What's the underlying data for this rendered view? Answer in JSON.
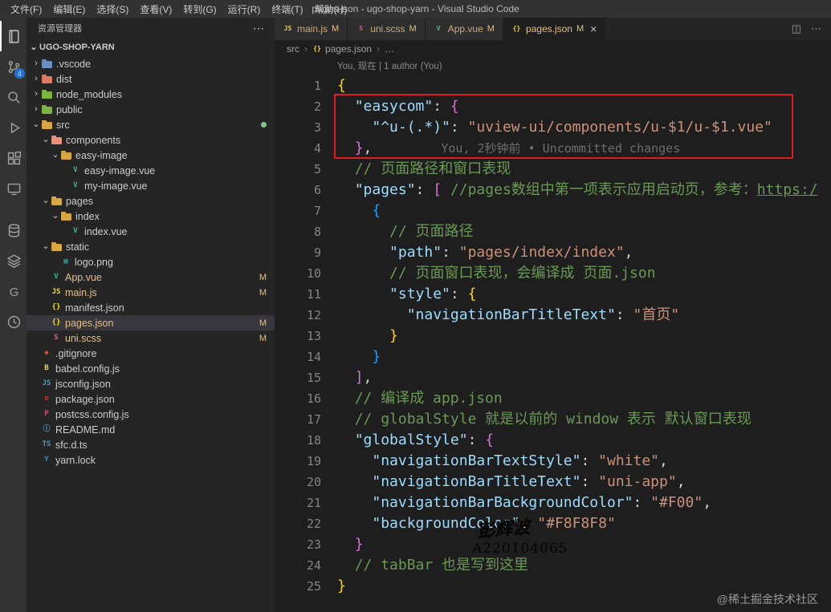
{
  "titlebar": {
    "menus": [
      "文件(F)",
      "编辑(E)",
      "选择(S)",
      "查看(V)",
      "转到(G)",
      "运行(R)",
      "终端(T)",
      "帮助(H)"
    ],
    "title": "pages.json - ugo-shop-yarn - Visual Studio Code"
  },
  "activity_bar": {
    "items": [
      {
        "icon": "explorer",
        "active": true
      },
      {
        "icon": "source-control",
        "badge": "4"
      },
      {
        "icon": "search"
      },
      {
        "icon": "run-debug"
      },
      {
        "icon": "extensions"
      },
      {
        "icon": "remote"
      },
      {
        "icon": "database",
        "group2": true
      },
      {
        "icon": "layers"
      },
      {
        "icon": "gitlens"
      },
      {
        "icon": "timeline"
      }
    ]
  },
  "sidebar": {
    "header": "资源管理器",
    "more_icon": "⋯",
    "project": "UGO-SHOP-YARN",
    "tree": [
      {
        "label": ".vscode",
        "level": 0,
        "kind": "folder",
        "icon": "folder-vscode",
        "expanded": false
      },
      {
        "label": "dist",
        "level": 0,
        "kind": "folder",
        "icon": "folder-dist",
        "expanded": false
      },
      {
        "label": "node_modules",
        "level": 0,
        "kind": "folder",
        "icon": "folder-node",
        "expanded": false
      },
      {
        "label": "public",
        "level": 0,
        "kind": "folder",
        "icon": "folder-public",
        "expanded": false
      },
      {
        "label": "src",
        "level": 0,
        "kind": "folder",
        "icon": "folder-src",
        "expanded": true,
        "dot": true
      },
      {
        "label": "components",
        "level": 1,
        "kind": "folder",
        "icon": "folder-components",
        "expanded": true
      },
      {
        "label": "easy-image",
        "level": 2,
        "kind": "folder",
        "icon": "folder-default",
        "expanded": true
      },
      {
        "label": "easy-image.vue",
        "level": 3,
        "kind": "file",
        "icon": "vue"
      },
      {
        "label": "my-image.vue",
        "level": 3,
        "kind": "file",
        "icon": "vue"
      },
      {
        "label": "pages",
        "level": 1,
        "kind": "folder",
        "icon": "folder-default",
        "expanded": true
      },
      {
        "label": "index",
        "level": 2,
        "kind": "folder",
        "icon": "folder-default",
        "expanded": true
      },
      {
        "label": "index.vue",
        "level": 3,
        "kind": "file",
        "icon": "vue"
      },
      {
        "label": "static",
        "level": 1,
        "kind": "folder",
        "icon": "folder-default",
        "expanded": true
      },
      {
        "label": "logo.png",
        "level": 2,
        "kind": "file",
        "icon": "image"
      },
      {
        "label": "App.vue",
        "level": 1,
        "kind": "file",
        "icon": "vue",
        "badge": "M",
        "modified": true
      },
      {
        "label": "main.js",
        "level": 1,
        "kind": "file",
        "icon": "js",
        "badge": "M",
        "modified": true
      },
      {
        "label": "manifest.json",
        "level": 1,
        "kind": "file",
        "icon": "json"
      },
      {
        "label": "pages.json",
        "level": 1,
        "kind": "file",
        "icon": "json",
        "badge": "M",
        "modified": true,
        "selected": true
      },
      {
        "label": "uni.scss",
        "level": 1,
        "kind": "file",
        "icon": "scss",
        "badge": "M",
        "modified": true
      },
      {
        "label": ".gitignore",
        "level": 0,
        "kind": "file",
        "icon": "git"
      },
      {
        "label": "babel.config.js",
        "level": 0,
        "kind": "file",
        "icon": "babel"
      },
      {
        "label": "jsconfig.json",
        "level": 0,
        "kind": "file",
        "icon": "jsconfig"
      },
      {
        "label": "package.json",
        "level": 0,
        "kind": "file",
        "icon": "npm"
      },
      {
        "label": "postcss.config.js",
        "level": 0,
        "kind": "file",
        "icon": "postcss"
      },
      {
        "label": "README.md",
        "level": 0,
        "kind": "file",
        "icon": "readme"
      },
      {
        "label": "sfc.d.ts",
        "level": 0,
        "kind": "file",
        "icon": "ts"
      },
      {
        "label": "yarn.lock",
        "level": 0,
        "kind": "file",
        "icon": "yarn"
      }
    ]
  },
  "icon_map": {
    "folder-vscode": {
      "shape": "folder",
      "color": "#6c8ebf",
      "name": "vscode-folder-icon"
    },
    "folder-dist": {
      "shape": "folder",
      "color": "#e07a5f",
      "name": "dist-folder-icon"
    },
    "folder-node": {
      "shape": "folder",
      "color": "#7cb342",
      "name": "node-modules-folder-icon"
    },
    "folder-public": {
      "shape": "folder",
      "color": "#7cb342",
      "name": "public-folder-icon"
    },
    "folder-src": {
      "shape": "folder",
      "color": "#d9a741",
      "name": "src-folder-icon"
    },
    "folder-components": {
      "shape": "folder",
      "color": "#e8927c",
      "name": "components-folder-icon"
    },
    "folder-default": {
      "shape": "folder",
      "color": "#d9a741",
      "name": "folder-icon"
    },
    "vue": {
      "glyph": "V",
      "color": "#41b883",
      "name": "vue-file-icon"
    },
    "js": {
      "glyph": "JS",
      "color": "#e8d44d",
      "name": "js-file-icon"
    },
    "json": {
      "glyph": "{}",
      "color": "#f5de19",
      "name": "json-file-icon"
    },
    "scss": {
      "glyph": "S",
      "color": "#cd6799",
      "name": "scss-file-icon"
    },
    "image": {
      "glyph": "▦",
      "color": "#26a69a",
      "name": "image-file-icon"
    },
    "git": {
      "glyph": "◆",
      "color": "#e84e31",
      "name": "git-file-icon"
    },
    "babel": {
      "glyph": "B",
      "color": "#f0d95b",
      "name": "babel-file-icon"
    },
    "jsconfig": {
      "glyph": "JS",
      "color": "#519aba",
      "name": "jsconfig-file-icon"
    },
    "npm": {
      "glyph": "n",
      "color": "#cb3837",
      "name": "npm-file-icon"
    },
    "postcss": {
      "glyph": "P",
      "color": "#dd4a68",
      "name": "postcss-file-icon"
    },
    "readme": {
      "glyph": "ⓘ",
      "color": "#42a5f5",
      "name": "readme-file-icon"
    },
    "ts": {
      "glyph": "TS",
      "color": "#519aba",
      "name": "ts-file-icon"
    },
    "yarn": {
      "glyph": "Y",
      "color": "#2c8ebb",
      "name": "yarn-file-icon"
    }
  },
  "tabs": [
    {
      "label": "main.js",
      "icon": "js",
      "badge": "M",
      "active": false
    },
    {
      "label": "uni.scss",
      "icon": "scss",
      "badge": "M",
      "active": false
    },
    {
      "label": "App.vue",
      "icon": "vue",
      "badge": "M",
      "active": false
    },
    {
      "label": "pages.json",
      "icon": "json",
      "badge": "M",
      "active": true
    }
  ],
  "tab_actions": [
    {
      "name": "split-editor-icon",
      "glyph": "◫"
    },
    {
      "name": "more-actions-icon",
      "glyph": "⋯"
    }
  ],
  "breadcrumb": [
    {
      "label": "src"
    },
    {
      "label": "pages.json",
      "icon": "json"
    },
    {
      "label": "…"
    }
  ],
  "editor": {
    "codelens": "You, 现在 | 1 author (You)",
    "lines": [
      [
        {
          "t": "{",
          "c": "b1"
        }
      ],
      [
        {
          "t": "  ",
          "c": "p"
        },
        {
          "t": "\"easycom\"",
          "c": "key"
        },
        {
          "t": ": ",
          "c": "p"
        },
        {
          "t": "{",
          "c": "b2"
        }
      ],
      [
        {
          "t": "    ",
          "c": "p"
        },
        {
          "t": "\"^u-(.*)\"",
          "c": "key"
        },
        {
          "t": ": ",
          "c": "p"
        },
        {
          "t": "\"uview-ui/components/u-$1/u-$1.vue\"",
          "c": "str"
        }
      ],
      [
        {
          "t": "  ",
          "c": "p"
        },
        {
          "t": "}",
          "c": "b2"
        },
        {
          "t": ",",
          "c": "p"
        },
        {
          "t": "You, 2秒钟前 • Uncommitted changes",
          "c": "blame"
        }
      ],
      [
        {
          "t": "  ",
          "c": "p"
        },
        {
          "t": "// 页面路径和窗口表现",
          "c": "com"
        }
      ],
      [
        {
          "t": "  ",
          "c": "p"
        },
        {
          "t": "\"pages\"",
          "c": "key"
        },
        {
          "t": ": ",
          "c": "p"
        },
        {
          "t": "[",
          "c": "b2"
        },
        {
          "t": " ",
          "c": "p"
        },
        {
          "t": "//pages数组中第一项表示应用启动页，参考：",
          "c": "com"
        },
        {
          "t": "https:/",
          "c": "link"
        }
      ],
      [
        {
          "t": "    ",
          "c": "p"
        },
        {
          "t": "{",
          "c": "b3"
        }
      ],
      [
        {
          "t": "      ",
          "c": "p"
        },
        {
          "t": "// 页面路径",
          "c": "com"
        }
      ],
      [
        {
          "t": "      ",
          "c": "p"
        },
        {
          "t": "\"path\"",
          "c": "key"
        },
        {
          "t": ": ",
          "c": "p"
        },
        {
          "t": "\"pages/index/index\"",
          "c": "str"
        },
        {
          "t": ",",
          "c": "p"
        }
      ],
      [
        {
          "t": "      ",
          "c": "p"
        },
        {
          "t": "// 页面窗口表现，会编译成 页面.json",
          "c": "com"
        }
      ],
      [
        {
          "t": "      ",
          "c": "p"
        },
        {
          "t": "\"style\"",
          "c": "key"
        },
        {
          "t": ": ",
          "c": "p"
        },
        {
          "t": "{",
          "c": "b1"
        }
      ],
      [
        {
          "t": "        ",
          "c": "p"
        },
        {
          "t": "\"navigationBarTitleText\"",
          "c": "key"
        },
        {
          "t": ": ",
          "c": "p"
        },
        {
          "t": "\"首页\"",
          "c": "str"
        }
      ],
      [
        {
          "t": "      ",
          "c": "p"
        },
        {
          "t": "}",
          "c": "b1"
        }
      ],
      [
        {
          "t": "    ",
          "c": "p"
        },
        {
          "t": "}",
          "c": "b3"
        }
      ],
      [
        {
          "t": "  ",
          "c": "p"
        },
        {
          "t": "]",
          "c": "b2"
        },
        {
          "t": ",",
          "c": "p"
        }
      ],
      [
        {
          "t": "  ",
          "c": "p"
        },
        {
          "t": "// 编译成 app.json",
          "c": "com"
        }
      ],
      [
        {
          "t": "  ",
          "c": "p"
        },
        {
          "t": "// globalStyle 就是以前的 window 表示 默认窗口表现",
          "c": "com"
        }
      ],
      [
        {
          "t": "  ",
          "c": "p"
        },
        {
          "t": "\"globalStyle\"",
          "c": "key"
        },
        {
          "t": ": ",
          "c": "p"
        },
        {
          "t": "{",
          "c": "b2"
        }
      ],
      [
        {
          "t": "    ",
          "c": "p"
        },
        {
          "t": "\"navigationBarTextStyle\"",
          "c": "key"
        },
        {
          "t": ": ",
          "c": "p"
        },
        {
          "t": "\"white\"",
          "c": "str"
        },
        {
          "t": ",",
          "c": "p"
        }
      ],
      [
        {
          "t": "    ",
          "c": "p"
        },
        {
          "t": "\"navigationBarTitleText\"",
          "c": "key"
        },
        {
          "t": ": ",
          "c": "p"
        },
        {
          "t": "\"uni-app\"",
          "c": "str"
        },
        {
          "t": ",",
          "c": "p"
        }
      ],
      [
        {
          "t": "    ",
          "c": "p"
        },
        {
          "t": "\"navigationBarBackgroundColor\"",
          "c": "key"
        },
        {
          "t": ": ",
          "c": "p"
        },
        {
          "t": "\"#F00\"",
          "c": "str"
        },
        {
          "t": ",",
          "c": "p"
        }
      ],
      [
        {
          "t": "    ",
          "c": "p"
        },
        {
          "t": "\"backgroundColor\"",
          "c": "key"
        },
        {
          "t": ": ",
          "c": "p"
        },
        {
          "t": "\"#F8F8F8\"",
          "c": "str"
        }
      ],
      [
        {
          "t": "  ",
          "c": "p"
        },
        {
          "t": "}",
          "c": "b2"
        }
      ],
      [
        {
          "t": "  ",
          "c": "p"
        },
        {
          "t": "// tabBar 也是写到这里",
          "c": "com"
        }
      ],
      [
        {
          "t": "}",
          "c": "b1"
        }
      ]
    ]
  },
  "annotations": {
    "watermark_name": "彭辉波",
    "watermark_id": "A220104065",
    "credit": "@稀土掘金技术社区"
  },
  "colors": {
    "badge_accent": "#2188ff",
    "modified": "#e2c08d",
    "annotation_red": "#e11d1d"
  }
}
